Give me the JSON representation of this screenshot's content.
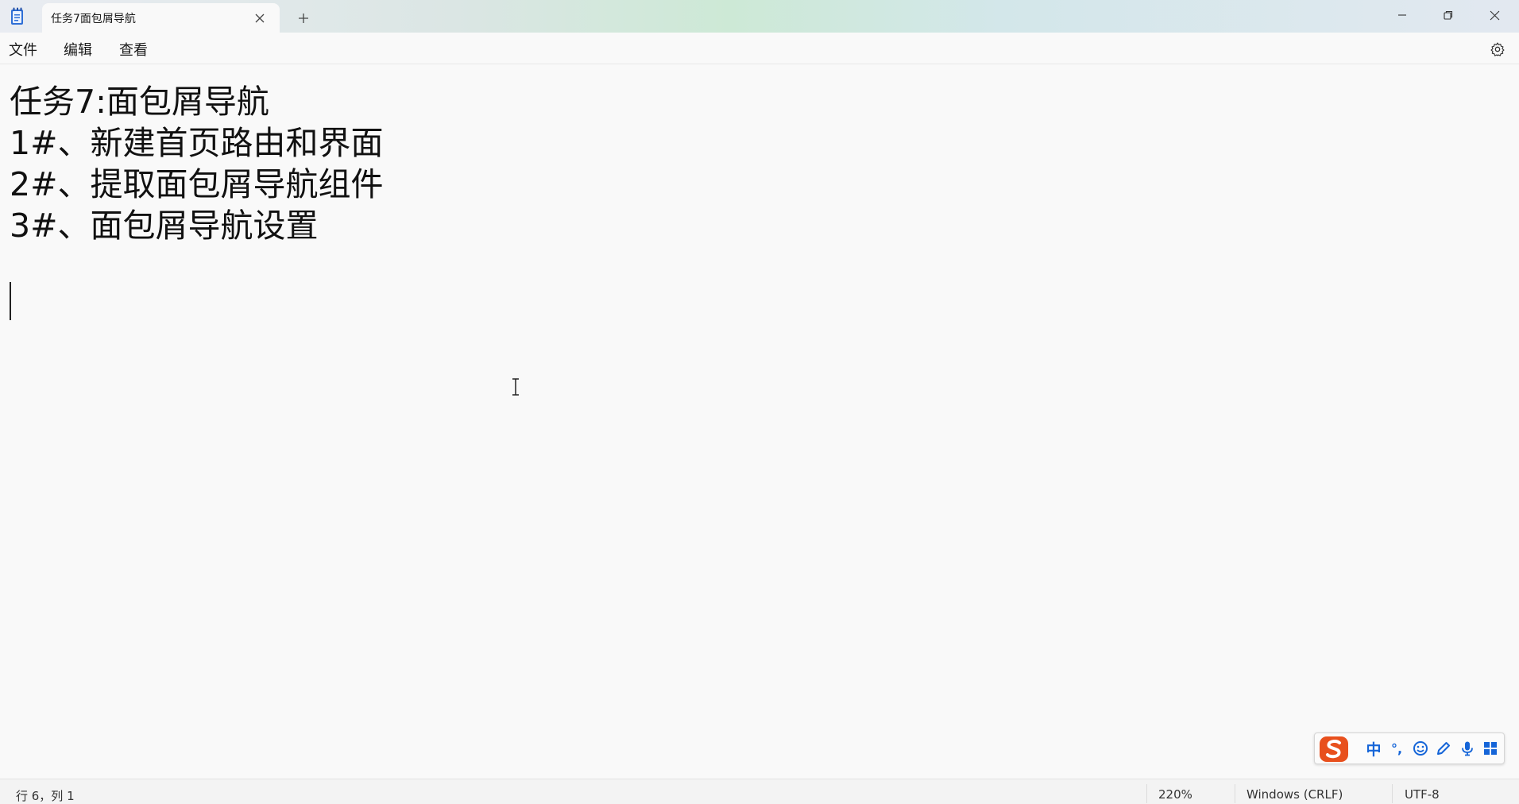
{
  "window": {
    "tab_title": "任务7面包屑导航",
    "new_tab_symbol": "+"
  },
  "menu": {
    "file": "文件",
    "edit": "编辑",
    "view": "查看"
  },
  "document": {
    "lines": [
      "任务7:面包屑导航",
      "1#、新建首页路由和界面",
      "2#、提取面包屑导航组件",
      "3#、面包屑导航设置"
    ]
  },
  "ime": {
    "mode_label": "中",
    "punct_label": "°,"
  },
  "status": {
    "position": "行 6，列 1",
    "zoom": "220%",
    "line_ending": "Windows (CRLF)",
    "encoding": "UTF-8"
  },
  "colors": {
    "ime_brand": "#e8501d",
    "ime_accent": "#1565d8"
  },
  "icons": [
    "notepad-app-icon",
    "close-icon",
    "plus-icon",
    "minimize-icon",
    "restore-icon",
    "settings-gear-icon",
    "ibeam-cursor-icon",
    "sogou-logo-icon",
    "emoji-icon",
    "pen-icon",
    "microphone-icon",
    "grid-icon"
  ]
}
